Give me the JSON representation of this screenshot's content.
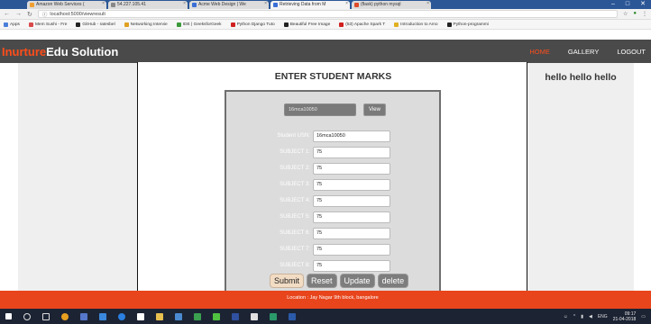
{
  "browser": {
    "tabs": [
      {
        "label": "Amazon Web Services (",
        "color": "#f0a030"
      },
      {
        "label": "54.227.105.41",
        "color": "#888888"
      },
      {
        "label": "Acme Web Design | We",
        "color": "#3b6fd6"
      },
      {
        "label": "Retrieving Data from M",
        "color": "#3b6fd6"
      },
      {
        "label": "(flask) python mysql",
        "color": "#e04a2a"
      }
    ],
    "window_controls": [
      "–",
      "□",
      "✕"
    ],
    "url": "localhost:5000/viewresult",
    "bookmarks": [
      {
        "label": "Apps",
        "color": "#4a7fd9"
      },
      {
        "label": "Mem Sushi - Fre",
        "color": "#d94a4a"
      },
      {
        "label": "GitHub - ratesbel",
        "color": "#222222"
      },
      {
        "label": "Networking Intervie",
        "color": "#e0a020"
      },
      {
        "label": "IDE | GeeksforGeek",
        "color": "#3a9a3a"
      },
      {
        "label": "Python Django Tuto",
        "color": "#d02020"
      },
      {
        "label": "Beautiful Free Image",
        "color": "#222222"
      },
      {
        "label": "(53) Apache Spark T",
        "color": "#d02020"
      },
      {
        "label": "Introduction to Amo",
        "color": "#e0b020"
      },
      {
        "label": "Python-programmi",
        "color": "#222222"
      }
    ]
  },
  "site": {
    "brand_part1": "Inurture",
    "brand_part2": "Edu Solution",
    "nav": [
      {
        "label": "HOME",
        "active": true
      },
      {
        "label": "GALLERY",
        "active": false
      },
      {
        "label": "LOGOUT",
        "active": false
      }
    ],
    "greeting": "hello hello hello",
    "form_title": "ENTER STUDENT MARKS",
    "search_value": "16mca10050",
    "view_label": "View",
    "usn_label": "Student USN:",
    "usn_value": "16mca10050",
    "subjects": [
      {
        "label": "SUBJECT 1:",
        "value": "75"
      },
      {
        "label": "SUBJECT 2:",
        "value": "75"
      },
      {
        "label": "SUBJECT 3:",
        "value": "75"
      },
      {
        "label": "SUBJECT 4:",
        "value": "75"
      },
      {
        "label": "SUBJECT 5:",
        "value": "75"
      },
      {
        "label": "SUBJECT 6:",
        "value": "75"
      },
      {
        "label": "SUBJECT 7:",
        "value": "75"
      },
      {
        "label": "SUBJECT 8:",
        "value": "75"
      }
    ],
    "buttons": {
      "submit": "Submit",
      "reset": "Reset",
      "update": "Update",
      "delete": "delete"
    },
    "footer_location": "Location : Jay Nagar 9th block, bangalore"
  },
  "taskbar": {
    "time": "09:17",
    "date": "21-04-2018",
    "lang": "ENG"
  },
  "colors": {
    "accent": "#e8451c",
    "navbar": "#4a4a4a"
  }
}
